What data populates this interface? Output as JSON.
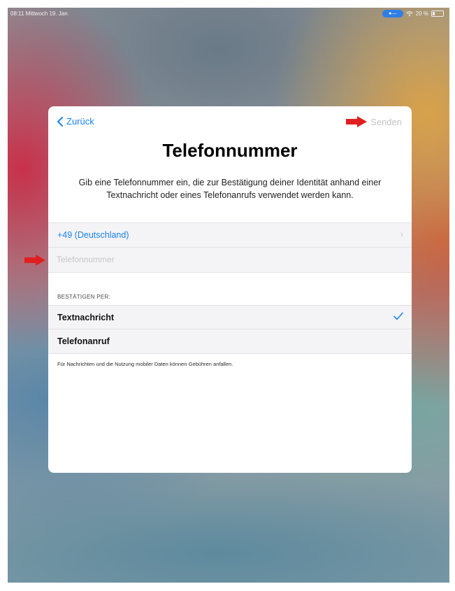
{
  "statusbar": {
    "time": "08:11",
    "date": "Mittwoch 19. Jan",
    "battery": "20 %"
  },
  "dialog": {
    "back_label": "Zurück",
    "send_label": "Senden",
    "title": "Telefonnummer",
    "description": "Gib eine Telefonnummer ein, die zur Bestätigung deiner Identität anhand einer Textnachricht oder eines Telefonanrufs verwendet werden kann.",
    "country_code": "+49 (Deutschland)",
    "phone_placeholder": "Telefonnummer",
    "phone_value": "",
    "verify_header": "BESTÄTIGEN PER:",
    "options": [
      {
        "label": "Textnachricht",
        "selected": true
      },
      {
        "label": "Telefonanruf",
        "selected": false
      }
    ],
    "footnote": "Für Nachrichten und die Nutzung mobiler Daten können Gebühren anfallen."
  },
  "colors": {
    "accent": "#1a83f0",
    "annotation_arrow": "#e02020"
  },
  "icons": [
    "chevron-left-icon",
    "chevron-right-icon",
    "checkmark-icon",
    "wifi-icon",
    "battery-icon",
    "red-arrow-annotation"
  ]
}
